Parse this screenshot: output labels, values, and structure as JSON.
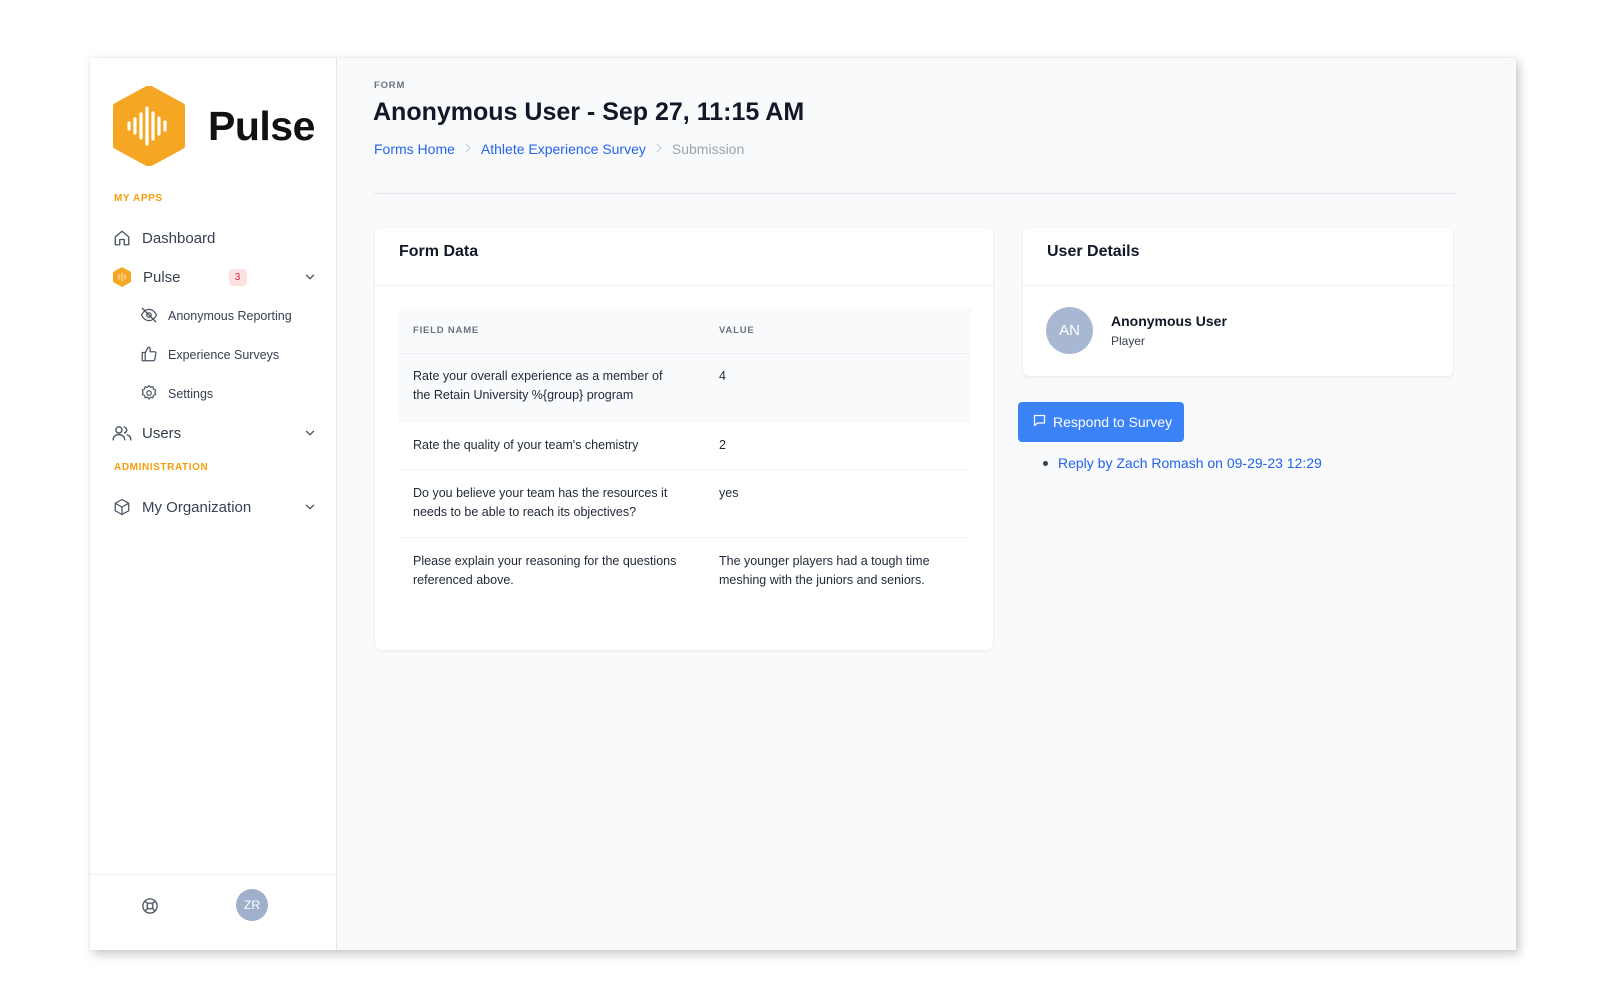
{
  "brand": {
    "name": "Pulse",
    "accent": "#f5a623"
  },
  "sidebar": {
    "my_apps_label": "MY APPS",
    "administration_label": "ADMINISTRATION",
    "items": {
      "dashboard": "Dashboard",
      "pulse": "Pulse",
      "pulse_badge": "3",
      "anonymous_reporting": "Anonymous Reporting",
      "experience_surveys": "Experience Surveys",
      "settings": "Settings",
      "users": "Users",
      "my_organization": "My Organization"
    },
    "footer": {
      "user_initials": "ZR"
    }
  },
  "header": {
    "eyebrow": "FORM",
    "title": "Anonymous User - Sep 27, 11:15 AM",
    "breadcrumb": [
      "Forms Home",
      "Athlete Experience Survey",
      "Submission"
    ]
  },
  "form_data": {
    "title": "Form Data",
    "columns": [
      "FIELD NAME",
      "VALUE"
    ],
    "rows": [
      {
        "field": "Rate your overall experience as a member of the Retain University %{group} program",
        "value": "4"
      },
      {
        "field": "Rate the quality of your team's chemistry",
        "value": "2"
      },
      {
        "field": "Do you believe your team has the resources it needs to be able to reach its objectives?",
        "value": "yes"
      },
      {
        "field": "Please explain your reasoning for the questions referenced above.",
        "value": "The younger players had a tough time meshing with the juniors and seniors."
      }
    ]
  },
  "user_details": {
    "title": "User Details",
    "initials": "AN",
    "name": "Anonymous User",
    "role": "Player"
  },
  "actions": {
    "respond_label": "Respond to Survey",
    "replies": [
      "Reply by Zach Romash on 09-29-23 12:29"
    ]
  }
}
